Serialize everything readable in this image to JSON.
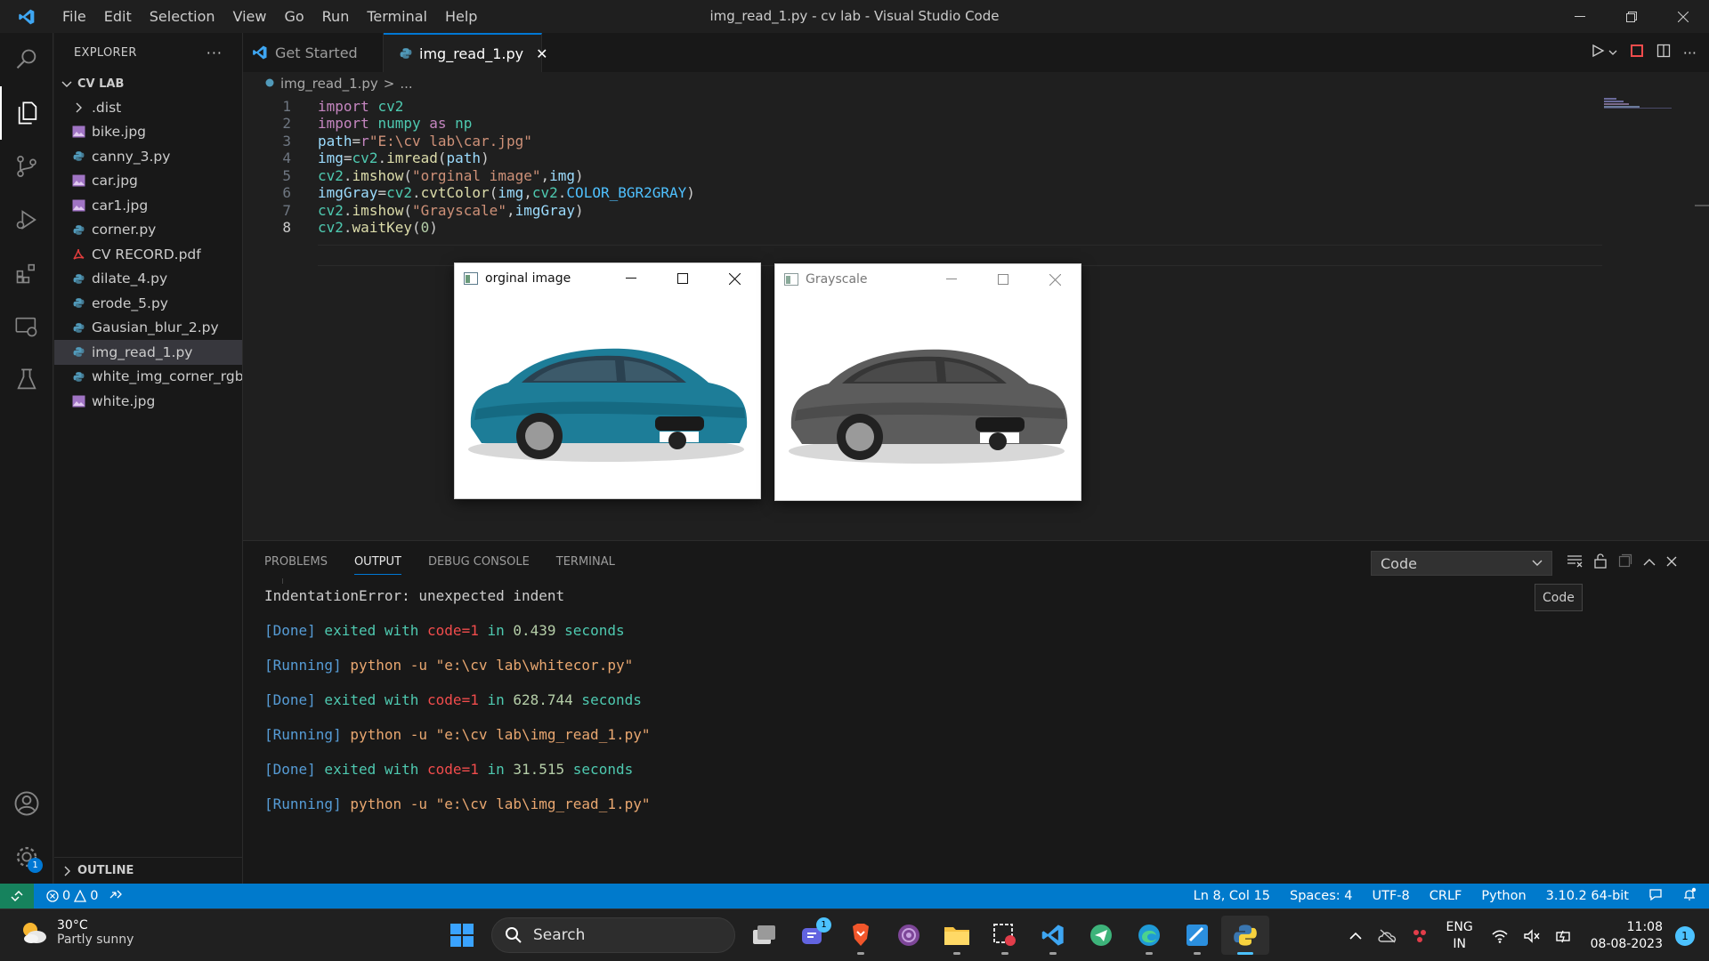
{
  "window": {
    "title": "img_read_1.py - cv lab - Visual Studio Code",
    "menu": [
      "File",
      "Edit",
      "Selection",
      "View",
      "Go",
      "Run",
      "Terminal",
      "Help"
    ]
  },
  "activity_bar": {
    "items": [
      "explorer-icon",
      "search-icon",
      "source-control-icon",
      "run-debug-icon",
      "extensions-icon",
      "remote-explorer-icon",
      "testing-icon"
    ],
    "settings_badge": "1"
  },
  "sidebar": {
    "header": "EXPLORER",
    "folder": "CV LAB",
    "files": [
      {
        "name": ".dist",
        "kind": "folder"
      },
      {
        "name": "bike.jpg",
        "kind": "image"
      },
      {
        "name": "canny_3.py",
        "kind": "python"
      },
      {
        "name": "car.jpg",
        "kind": "image"
      },
      {
        "name": "car1.jpg",
        "kind": "image"
      },
      {
        "name": "corner.py",
        "kind": "python"
      },
      {
        "name": "CV RECORD.pdf",
        "kind": "pdf"
      },
      {
        "name": "dilate_4.py",
        "kind": "python"
      },
      {
        "name": "erode_5.py",
        "kind": "python"
      },
      {
        "name": "Gausian_blur_2.py",
        "kind": "python"
      },
      {
        "name": "img_read_1.py",
        "kind": "python",
        "selected": true
      },
      {
        "name": "white_img_corner_rgb...",
        "kind": "python"
      },
      {
        "name": "white.jpg",
        "kind": "image"
      }
    ],
    "outline": "OUTLINE"
  },
  "tabs": [
    {
      "label": "Get Started",
      "active": false
    },
    {
      "label": "img_read_1.py",
      "active": true,
      "close": "✕"
    }
  ],
  "breadcrumb": {
    "file": "img_read_1.py",
    "sep": ">",
    "more": "..."
  },
  "code_lines": [
    {
      "num": "1",
      "tokens": [
        [
          "kw",
          "import"
        ],
        [
          "pl",
          " "
        ],
        [
          "mod",
          "cv2"
        ]
      ]
    },
    {
      "num": "2",
      "tokens": [
        [
          "kw",
          "import"
        ],
        [
          "pl",
          " "
        ],
        [
          "mod",
          "numpy"
        ],
        [
          "pl",
          " "
        ],
        [
          "kw",
          "as"
        ],
        [
          "pl",
          " "
        ],
        [
          "mod",
          "np"
        ]
      ]
    },
    {
      "num": "3",
      "tokens": [
        [
          "id",
          "path"
        ],
        [
          "pl",
          "="
        ],
        [
          "kw",
          "r"
        ],
        [
          "str",
          "\"E:\\cv lab\\car.jpg\""
        ]
      ]
    },
    {
      "num": "4",
      "tokens": [
        [
          "id",
          "img"
        ],
        [
          "pl",
          "="
        ],
        [
          "mod",
          "cv2"
        ],
        [
          "pl",
          "."
        ],
        [
          "fn",
          "imread"
        ],
        [
          "pl",
          "("
        ],
        [
          "id",
          "path"
        ],
        [
          "pl",
          ")"
        ]
      ]
    },
    {
      "num": "5",
      "tokens": [
        [
          "mod",
          "cv2"
        ],
        [
          "pl",
          "."
        ],
        [
          "fn",
          "imshow"
        ],
        [
          "pl",
          "("
        ],
        [
          "str",
          "\"orginal image\""
        ],
        [
          "pl",
          ","
        ],
        [
          "id",
          "img"
        ],
        [
          "pl",
          ")"
        ]
      ]
    },
    {
      "num": "6",
      "tokens": [
        [
          "id",
          "imgGray"
        ],
        [
          "pl",
          "="
        ],
        [
          "mod",
          "cv2"
        ],
        [
          "pl",
          "."
        ],
        [
          "fn",
          "cvtColor"
        ],
        [
          "pl",
          "("
        ],
        [
          "id",
          "img"
        ],
        [
          "pl",
          ","
        ],
        [
          "mod",
          "cv2"
        ],
        [
          "pl",
          "."
        ],
        [
          "cst",
          "COLOR_BGR2GRAY"
        ],
        [
          "pl",
          ")"
        ]
      ]
    },
    {
      "num": "7",
      "tokens": [
        [
          "mod",
          "cv2"
        ],
        [
          "pl",
          "."
        ],
        [
          "fn",
          "imshow"
        ],
        [
          "pl",
          "("
        ],
        [
          "str",
          "\"Grayscale\""
        ],
        [
          "pl",
          ","
        ],
        [
          "id",
          "imgGray"
        ],
        [
          "pl",
          ")"
        ]
      ]
    },
    {
      "num": "8",
      "tokens": [
        [
          "mod",
          "cv2"
        ],
        [
          "pl",
          "."
        ],
        [
          "fn",
          "waitKey"
        ],
        [
          "pl",
          "("
        ],
        [
          "num",
          "0"
        ],
        [
          "pl",
          ")"
        ]
      ]
    }
  ],
  "image_windows": [
    {
      "title": "orginal image",
      "style": "color"
    },
    {
      "title": "Grayscale",
      "style": "gray"
    }
  ],
  "panel": {
    "tabs": [
      "PROBLEMS",
      "OUTPUT",
      "DEBUG CONSOLE",
      "TERMINAL"
    ],
    "active_tab": "OUTPUT",
    "select_value": "Code",
    "tooltip": "Code",
    "output": [
      [
        [
          "pl",
          "IndentationError: unexpected indent"
        ]
      ],
      [
        [
          "o-bracket",
          "[Done]"
        ],
        [
          "o-done",
          " exited with "
        ],
        [
          "o-code",
          "code=1"
        ],
        [
          "o-done",
          " in "
        ],
        [
          "o-num",
          "0.439"
        ],
        [
          "o-done",
          " seconds"
        ]
      ],
      [
        [
          "o-bracket",
          "[Running]"
        ],
        [
          "o-run",
          " python -u \"e:\\cv lab\\whitecor.py\""
        ]
      ],
      [
        [
          "o-bracket",
          "[Done]"
        ],
        [
          "o-done",
          " exited with "
        ],
        [
          "o-code",
          "code=1"
        ],
        [
          "o-done",
          " in "
        ],
        [
          "o-num",
          "628.744"
        ],
        [
          "o-done",
          " seconds"
        ]
      ],
      [
        [
          "o-bracket",
          "[Running]"
        ],
        [
          "o-run",
          " python -u \"e:\\cv lab\\img_read_1.py\""
        ]
      ],
      [
        [
          "o-bracket",
          "[Done]"
        ],
        [
          "o-done",
          " exited with "
        ],
        [
          "o-code",
          "code=1"
        ],
        [
          "o-done",
          " in "
        ],
        [
          "o-num",
          "31.515"
        ],
        [
          "o-done",
          " seconds"
        ]
      ],
      [
        [
          "o-bracket",
          "[Running]"
        ],
        [
          "o-run",
          " python -u \"e:\\cv lab\\img_read_1.py\""
        ]
      ]
    ]
  },
  "statusbar": {
    "errors": "0",
    "warnings": "0",
    "position": "Ln 8, Col 15",
    "spaces": "Spaces: 4",
    "encoding": "UTF-8",
    "eol": "CRLF",
    "language": "Python",
    "interpreter": "3.10.2 64-bit"
  },
  "taskbar": {
    "temp": "30°C",
    "weather": "Partly sunny",
    "search": "Search",
    "teams_badge": "1",
    "lang_top": "ENG",
    "lang_bottom": "IN",
    "time": "11:08",
    "date": "08-08-2023",
    "notifications": "1"
  },
  "colors": {
    "accent": "#007acc",
    "editor_bg": "#1f1f1f",
    "side_bg": "#181818"
  }
}
